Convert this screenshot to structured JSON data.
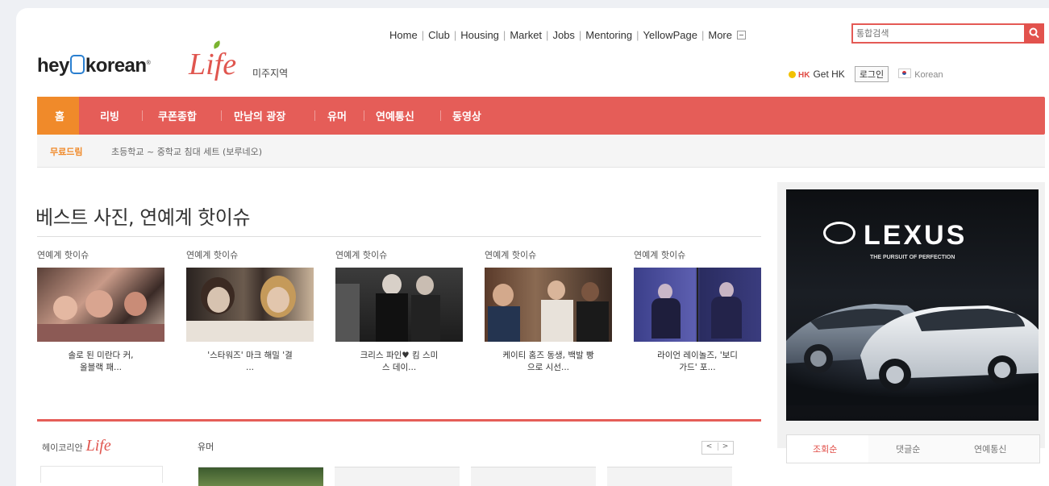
{
  "header": {
    "logo": {
      "brand_left": "hey",
      "brand_right": "korean",
      "life": "Life",
      "region": "미주지역"
    },
    "topnav": [
      "Home",
      "Club",
      "Housing",
      "Market",
      "Jobs",
      "Mentoring",
      "YellowPage",
      "More"
    ],
    "search": {
      "placeholder": "통합검색"
    },
    "util": {
      "hk_label": "HK",
      "get_hk": "Get HK",
      "login": "로그인",
      "language": "Korean"
    }
  },
  "mainnav": {
    "home": "홈",
    "tabs": [
      "리빙",
      "쿠폰종합",
      "만남의 광장",
      "유머",
      "연예통신",
      "동영상"
    ]
  },
  "ticker": {
    "label": "무료드림",
    "text": "초등학교 ~ 중학교 침대 세트 (보루네오)"
  },
  "section": {
    "title": "베스트 사진, 연예계 핫이슈",
    "cards": [
      {
        "category": "연예계 핫이슈",
        "caption_1": "솔로 된 미란다 커,",
        "caption_2": "올블랙 패..."
      },
      {
        "category": "연예계 핫이슈",
        "caption_1": "'스타워즈' 마크 해밀 '결",
        "caption_2": "..."
      },
      {
        "category": "연예계 핫이슈",
        "caption_1": "크리스 파인♥ 킴 스미",
        "caption_2": "스 데이..."
      },
      {
        "category": "연예계 핫이슈",
        "caption_1": "케이티 홈즈 동생, 백발 빵",
        "caption_2": "으로 시선..."
      },
      {
        "category": "연예계 핫이슈",
        "caption_1": "라이언 레이놀즈, '보디",
        "caption_2": "가드' 포..."
      }
    ]
  },
  "bottom": {
    "logo_text": "헤이코리안",
    "life": "Life",
    "humor": "유머",
    "pager_prev": "<",
    "pager_next": ">"
  },
  "ad": {
    "brand": "LEXUS",
    "tagline": "THE PURSUIT OF PERFECTION"
  },
  "right_tabs": [
    "조회순",
    "댓글순",
    "연예통신"
  ]
}
